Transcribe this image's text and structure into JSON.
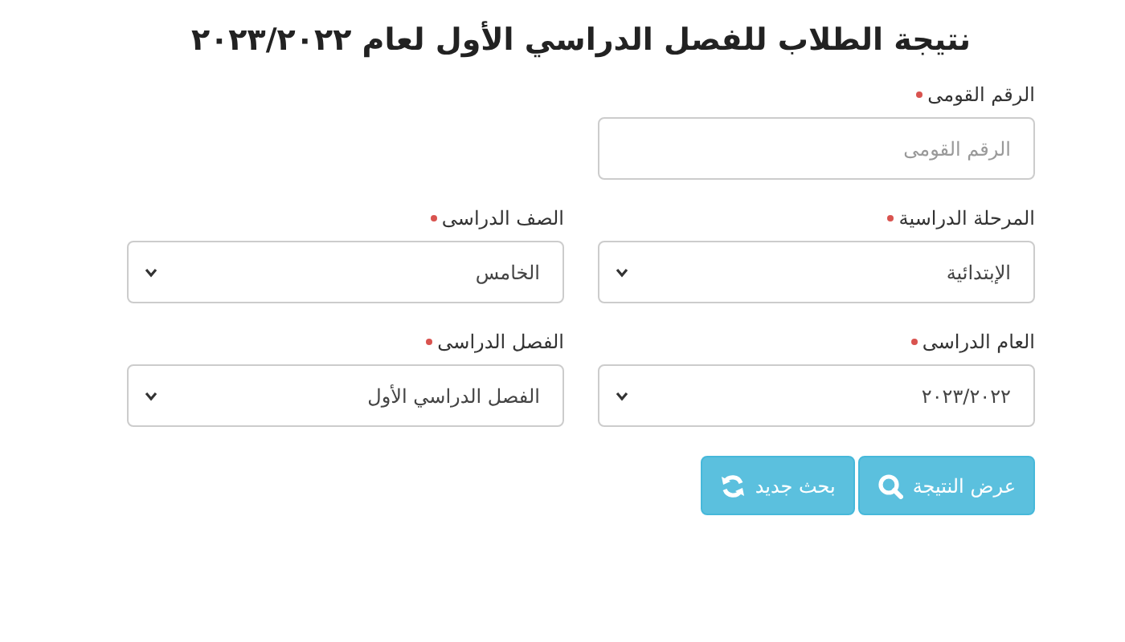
{
  "title": "نتيجة الطلاب للفصل الدراسي الأول لعام ٢٠٢٣/٢٠٢٢",
  "fields": [
    {
      "kind": "text",
      "label": "الرقم القومى",
      "required": true,
      "placeholder": "الرقم القومى"
    },
    {
      "kind": "select",
      "label": "المرحلة الدراسية",
      "required": true,
      "value": "الإبتدائية"
    },
    {
      "kind": "select",
      "label": "الصف الدراسى",
      "required": true,
      "value": "الخامس"
    },
    {
      "kind": "select",
      "label": "العام الدراسى",
      "required": true,
      "value": "٢٠٢٣/٢٠٢٢"
    },
    {
      "kind": "select",
      "label": "الفصل الدراسى",
      "required": true,
      "value": "الفصل الدراسي الأول"
    }
  ],
  "buttons": [
    {
      "label": "عرض النتيجة",
      "kind": "search"
    },
    {
      "label": "بحث جديد",
      "kind": "refresh"
    }
  ]
}
